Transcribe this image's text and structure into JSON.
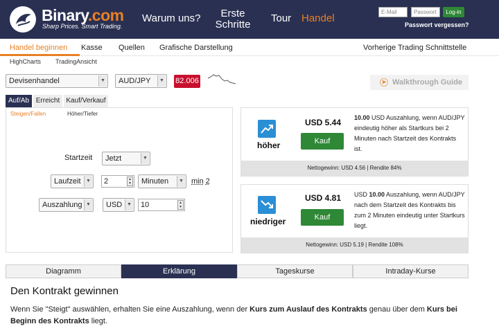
{
  "header": {
    "brand_name": "Binary",
    "brand_suffix": ".com",
    "slogan": "Sharp Prices. Smart Trading.",
    "nav": [
      "Warum uns?",
      "Erste Schritte",
      "Tour",
      "Handel"
    ],
    "active_nav": "Handel",
    "email_placeholder": "E-Mail",
    "password_placeholder": "Passwort",
    "login_label": "Log-in",
    "forgot_password": "Passwort vergessen?",
    "bg_color": "#2a3052",
    "accent_color": "#e98024"
  },
  "subnav": {
    "items": [
      "Handel beginnen",
      "Kasse",
      "Quellen",
      "Grafische Darstellung"
    ],
    "right_item": "Vorherige Trading Schnittstelle",
    "tertiary": [
      "HighCharts",
      "TradingAnsicht"
    ]
  },
  "market": {
    "market_select": "Devisenhandel",
    "symbol_select": "AUD/JPY",
    "spot_price": "82.006",
    "walkthrough_label": "Walkthrough Guide"
  },
  "contract": {
    "tabs": [
      "Auf/Ab",
      "Erreicht",
      "Kauf/Verkauf"
    ],
    "active_tab": "Auf/Ab",
    "subtabs": [
      "Steigen/Fallen",
      "Höher/Tiefer"
    ],
    "start_label": "Startzeit",
    "start_value": "Jetzt",
    "duration_select": "Laufzeit",
    "duration_value": "2",
    "duration_unit": "Minuten",
    "duration_min_prefix": "min",
    "duration_min_value": "2",
    "payout_select": "Auszahlung",
    "currency": "USD",
    "amount": "10"
  },
  "purchase": {
    "higher": {
      "label": "höher",
      "price": "USD 5.44",
      "buy_label": "Kauf",
      "desc_amount": "10.00",
      "desc_text": " USD Auszahlung, wenn AUD/JPY eindeutig höher als Startkurs bei 2 Minuten nach Startzeit des Kontrakts ist.",
      "footer": "Nettogewinn: USD 4.56 | Rendite 84%"
    },
    "lower": {
      "label": "niedriger",
      "price": "USD 4.81",
      "buy_label": "Kauf",
      "desc_prefix": "USD ",
      "desc_amount": "10.00",
      "desc_text": " Auszahlung, wenn AUD/JPY nach dem Startzeit des Kontrakts bis zum 2 Minuten eindeutig unter Startkurs liegt.",
      "footer": "Nettogewinn: USD 5.19 | Rendite 108%"
    },
    "icon_color": "#2b8fd5",
    "buy_color": "#2e8836"
  },
  "bottom_tabs": [
    "Diagramm",
    "Erklärung",
    "Tageskurse",
    "Intraday-Kurse"
  ],
  "active_bottom_tab": "Erklärung",
  "explanation": {
    "heading": "Den Kontrakt gewinnen",
    "p_1": "Wenn Sie \"Steigt\" auswählen, erhalten Sie eine Auszahlung, wenn der ",
    "bold_1": "Kurs zum Auslauf des Kontrakts",
    "p_2": " genau über dem ",
    "bold_2": "Kurs bei Beginn des Kontrakts",
    "p_3": " liegt."
  }
}
